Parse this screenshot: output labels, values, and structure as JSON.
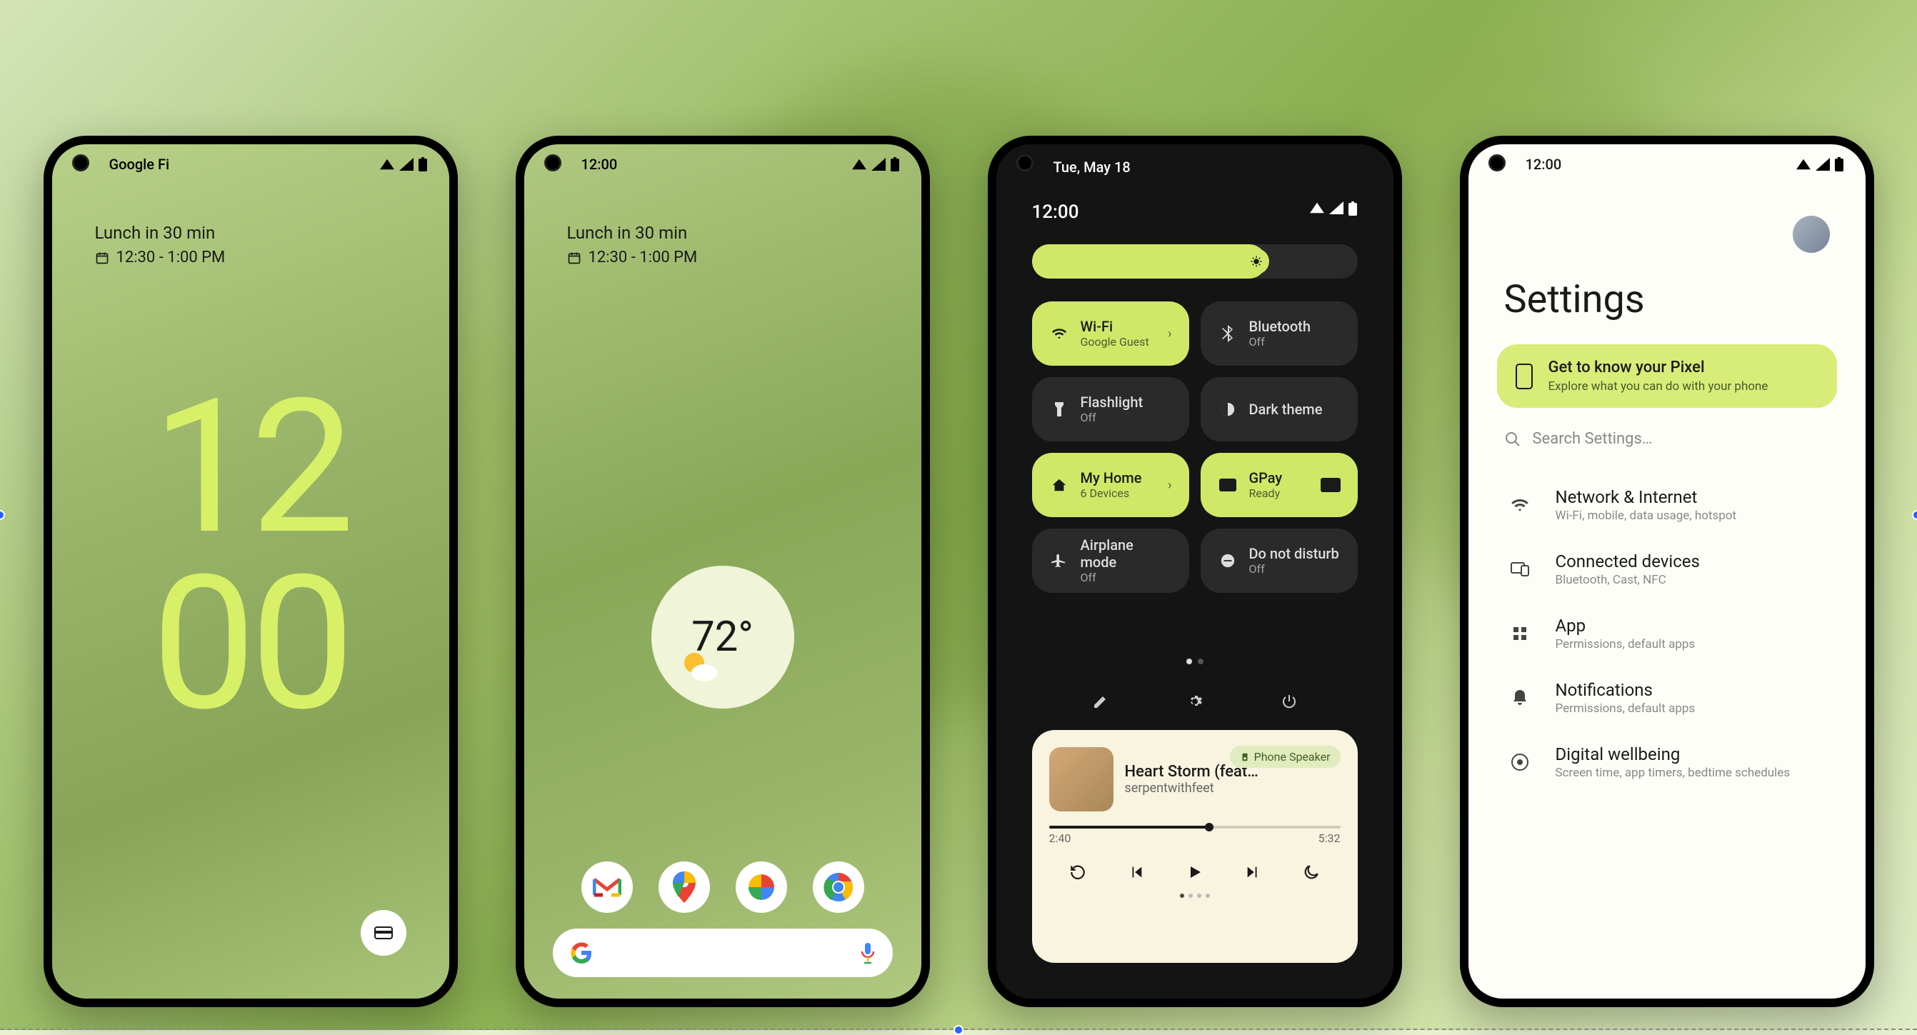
{
  "colors": {
    "accent": "#d0e868",
    "dark": "#141414",
    "light_bg": "#fefef8"
  },
  "phone1": {
    "status_left": "Google Fi",
    "lock_title": "Lunch in 30 min",
    "lock_time": "12:30 - 1:00 PM",
    "clock_top": "12",
    "clock_bottom": "00"
  },
  "phone2": {
    "status_left": "12:00",
    "lock_title": "Lunch in 30 min",
    "lock_time": "12:30 - 1:00 PM",
    "temperature": "72°",
    "dock": [
      "Gmail",
      "Maps",
      "Photos",
      "Chrome"
    ]
  },
  "phone3": {
    "date": "Tue, May 18",
    "time": "12:00",
    "tiles": [
      {
        "title": "Wi-Fi",
        "sub": "Google Guest",
        "on": true,
        "icon": "wifi",
        "chevron": true
      },
      {
        "title": "Bluetooth",
        "sub": "Off",
        "on": false,
        "icon": "bluetooth"
      },
      {
        "title": "Flashlight",
        "sub": "Off",
        "on": false,
        "icon": "flashlight"
      },
      {
        "title": "Dark theme",
        "sub": "",
        "on": false,
        "icon": "dark"
      },
      {
        "title": "My Home",
        "sub": "6 Devices",
        "on": true,
        "icon": "home",
        "chevron": true
      },
      {
        "title": "GPay",
        "sub": "Ready",
        "on": true,
        "icon": "gpay",
        "trail": "card"
      },
      {
        "title": "Airplane mode",
        "sub": "Off",
        "on": false,
        "icon": "airplane"
      },
      {
        "title": "Do not disturb",
        "sub": "Off",
        "on": false,
        "icon": "dnd"
      }
    ],
    "media": {
      "title": "Heart Storm (feat…",
      "artist": "serpentwithfeet",
      "output": "Phone Speaker",
      "elapsed": "2:40",
      "duration": "5:32"
    }
  },
  "phone4": {
    "status_left": "12:00",
    "title": "Settings",
    "pixel_card_title": "Get to know your Pixel",
    "pixel_card_sub": "Explore what you can do with your phone",
    "search_placeholder": "Search Settings…",
    "items": [
      {
        "title": "Network & Internet",
        "sub": "Wi-Fi, mobile, data usage, hotspot",
        "icon": "wifi"
      },
      {
        "title": "Connected devices",
        "sub": "Bluetooth, Cast, NFC",
        "icon": "devices"
      },
      {
        "title": "App",
        "sub": "Permissions, default apps",
        "icon": "apps"
      },
      {
        "title": "Notifications",
        "sub": "Permissions, default apps",
        "icon": "bell"
      },
      {
        "title": "Digital wellbeing",
        "sub": "Screen time, app timers, bedtime schedules",
        "icon": "wellbeing"
      }
    ]
  }
}
